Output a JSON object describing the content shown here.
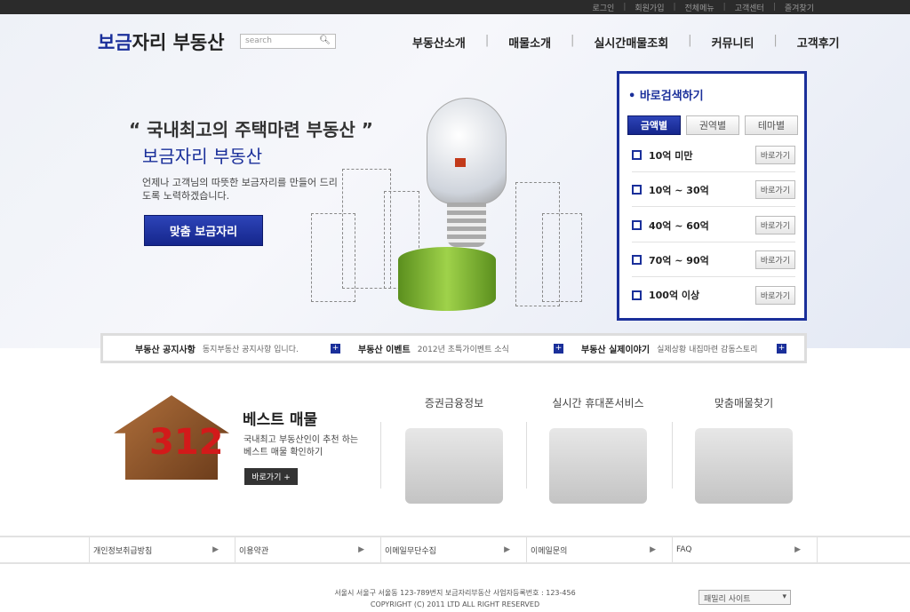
{
  "topbar": {
    "items": [
      "로그인",
      "회원가입",
      "전체메뉴",
      "고객센터",
      "즐겨찾기"
    ]
  },
  "header": {
    "logo_accent": "보금",
    "logo_rest": "자리 부동산",
    "search_placeholder": "search",
    "nav": [
      "부동산소개",
      "매물소개",
      "실시간매물조회",
      "커뮤니티",
      "고객후기"
    ]
  },
  "hero": {
    "quote": "“ 국내최고의 주택마련 부동산 ”",
    "subtitle": "보금자리 부동산",
    "desc": "언제나 고객님의 따뜻한 보금자리를 만들어 드리도록 노력하겠습니다.",
    "cta": "맞춤 보금자리"
  },
  "quick_search": {
    "title": "• 바로검색하기",
    "tabs": [
      "금액별",
      "권역별",
      "테마별"
    ],
    "active_tab": 0,
    "go_label": "바로가기",
    "rows": [
      "10억 미만",
      "10억 ~ 30억",
      "40억 ~ 60억",
      "70억 ~ 90억",
      "100억 이상"
    ]
  },
  "notices": [
    {
      "title": "부동산 공지사항",
      "text": "동지부동산 공지사항 입니다."
    },
    {
      "title": "부동산 이벤트",
      "text": "2012년 초특가이벤트 소식"
    },
    {
      "title": "부동산 실제이야기",
      "text": "실제상황 내집마련 감동스토리"
    }
  ],
  "best": {
    "numbers": "312",
    "title": "베스트 매물",
    "desc1": "국내최고 부동산인이 추천 하는",
    "desc2": "베스트 매물 확인하기",
    "button": "바로가기 +"
  },
  "services": [
    "증권금융정보",
    "실시간 휴대폰서비스",
    "맞춤매물찾기"
  ],
  "footer": {
    "links": [
      "개인정보취급방침",
      "이용약관",
      "이메일무단수집",
      "이메일문의",
      "FAQ"
    ],
    "address": "서울시 서울구 서울동 123-789번지 보금자리부동산 사업자등록번호 : 123-456",
    "copyright": "COPYRIGHT (C) 2011 LTD ALL RIGHT RESERVED",
    "family_site": "패밀리 사이트"
  }
}
